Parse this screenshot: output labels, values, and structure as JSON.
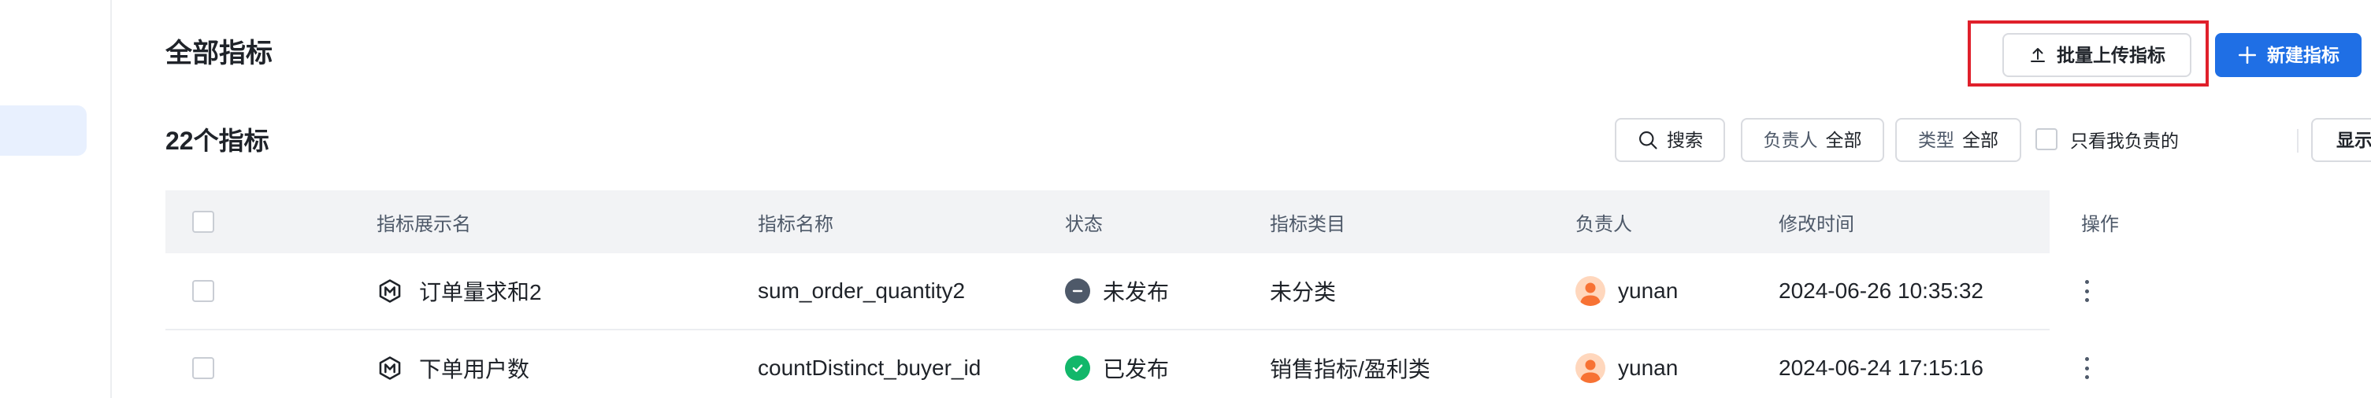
{
  "header": {
    "title": "全部指标",
    "upload_button": "批量上传指标",
    "new_button": "新建指标"
  },
  "toolbar": {
    "count_title": "22个指标",
    "search_label": "搜索",
    "owner_key": "负责人",
    "owner_value": "全部",
    "type_key": "类型",
    "type_value": "全部",
    "only_mine_label": "只看我负责的",
    "fields_label": "显示字段"
  },
  "table": {
    "columns": {
      "display_name": "指标展示名",
      "name": "指标名称",
      "status": "状态",
      "category": "指标类目",
      "owner": "负责人",
      "modified": "修改时间",
      "ops": "操作"
    },
    "rows": [
      {
        "display_name": "订单量求和2",
        "name": "sum_order_quantity2",
        "status": "未发布",
        "category": "未分类",
        "owner": "yunan",
        "modified": "2024-06-26 10:35:32"
      },
      {
        "display_name": "下单用户数",
        "name": "countDistinct_buyer_id",
        "status": "已发布",
        "category": "销售指标/盈利类",
        "owner": "yunan",
        "modified": "2024-06-24 17:15:16"
      }
    ]
  },
  "colors": {
    "primary": "#1f6fe5",
    "highlight": "#e0202b",
    "published": "#12b76a",
    "unpublished": "#4e5969",
    "avatar": "#f77234"
  },
  "icons": {
    "upload": "upload-icon",
    "plus": "plus-icon",
    "search": "search-icon",
    "metric": "metric-m-icon",
    "unpublished": "minus-circle-icon",
    "published": "check-circle-icon",
    "avatar": "user-avatar-icon",
    "more": "more-vertical-icon",
    "caret": "caret-down-icon"
  }
}
